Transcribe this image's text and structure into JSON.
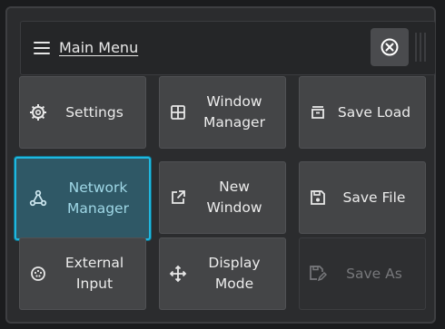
{
  "header": {
    "title": "Main Menu"
  },
  "colors": {
    "accent": "#1fb8e0",
    "active_bg": "#2f5866",
    "button_bg": "#444547",
    "panel_bg": "#2b2c2e"
  },
  "menu": {
    "settings": "Settings",
    "window_manager": "Window\nManager",
    "save_load": "Save Load",
    "network_manager": "Network\nManager",
    "new_window": "New\nWindow",
    "save_file": "Save File",
    "external_input": "External\nInput",
    "display_mode": "Display\nMode",
    "save_as": "Save As"
  },
  "icons": {
    "menu": "hamburger-icon",
    "close": "close-circle-icon",
    "settings": "gear-icon",
    "window_manager": "grid-icon",
    "save_load": "archive-icon",
    "network": "network-icon",
    "new_window": "external-link-icon",
    "save_file": "floppy-icon",
    "external_input": "input-port-icon",
    "display_mode": "move-arrows-icon",
    "save_as": "save-edit-icon"
  }
}
